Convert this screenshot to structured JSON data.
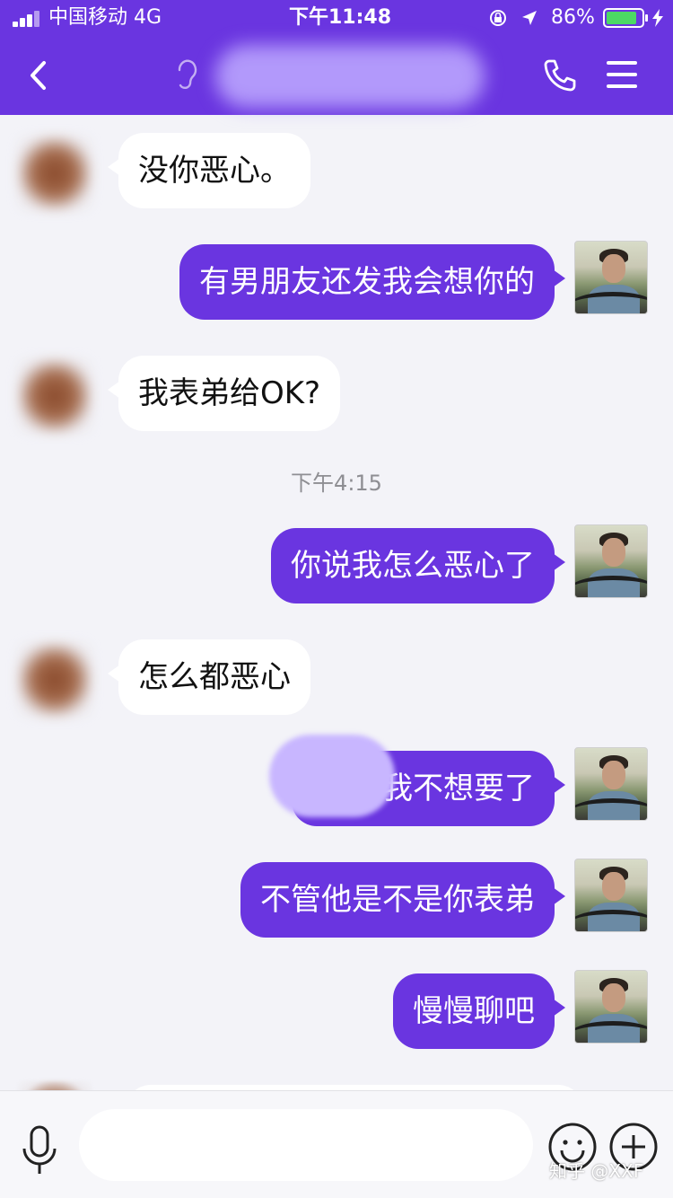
{
  "status_bar": {
    "carrier": "中国移动 4G",
    "time": "下午11:48",
    "battery_percent_label": "86%",
    "battery_level": 0.86
  },
  "header": {
    "title": ""
  },
  "messages": [
    {
      "side": "them",
      "text": "没你恶心。"
    },
    {
      "side": "me",
      "text": "有男朋友还发我会想你的"
    },
    {
      "side": "them",
      "text": "我表弟给OK?"
    },
    {
      "side": "me",
      "text": "你说我怎么恶心了"
    },
    {
      "side": "them",
      "text": "怎么都恶心"
    },
    {
      "side": "me",
      "text": "还有       我不想要了"
    },
    {
      "side": "me",
      "text": "不管他是不是你表弟"
    },
    {
      "side": "me",
      "text": "慢慢聊吧"
    }
  ],
  "timestamp": "下午4:15",
  "input": {
    "value": "",
    "placeholder": ""
  },
  "watermark": "知乎 @XXF",
  "colors": {
    "accent": "#6a35e0",
    "background": "#f3f3f8",
    "incoming_bubble": "#ffffff",
    "battery_fill": "#4cd964"
  },
  "icons": [
    "signal-icon",
    "lock-rotation-icon",
    "location-arrow-icon",
    "battery-icon",
    "charging-bolt-icon",
    "back-chevron-icon",
    "ear-icon",
    "phone-icon",
    "menu-icon",
    "microphone-icon",
    "emoji-icon",
    "plus-icon"
  ]
}
